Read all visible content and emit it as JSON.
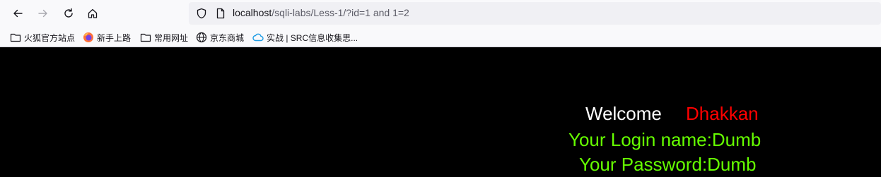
{
  "browser": {
    "url_host": "localhost",
    "url_rest": "/sqli-labs/Less-1/?id=1 and 1=2",
    "icons": {
      "back": "back-arrow-icon",
      "forward": "forward-arrow-icon",
      "reload": "reload-icon",
      "home": "home-icon",
      "tracking": "shield-icon",
      "page": "page-icon"
    }
  },
  "bookmarks": [
    {
      "label": "火狐官方站点",
      "icon": "folder-icon"
    },
    {
      "label": "新手上路",
      "icon": "firefox-icon"
    },
    {
      "label": "常用网址",
      "icon": "folder-icon"
    },
    {
      "label": "京东商城",
      "icon": "globe-icon"
    },
    {
      "label": "实战 | SRC信息收集思...",
      "icon": "cloud-icon"
    }
  ],
  "page": {
    "welcome": "Welcome",
    "user": "Dhakkan",
    "login_name": "Your Login name:Dumb",
    "password": "Your Password:Dumb",
    "colors": {
      "background": "#000000",
      "welcome": "#ffffff",
      "user": "#ff0000",
      "info": "#66ff00"
    }
  }
}
